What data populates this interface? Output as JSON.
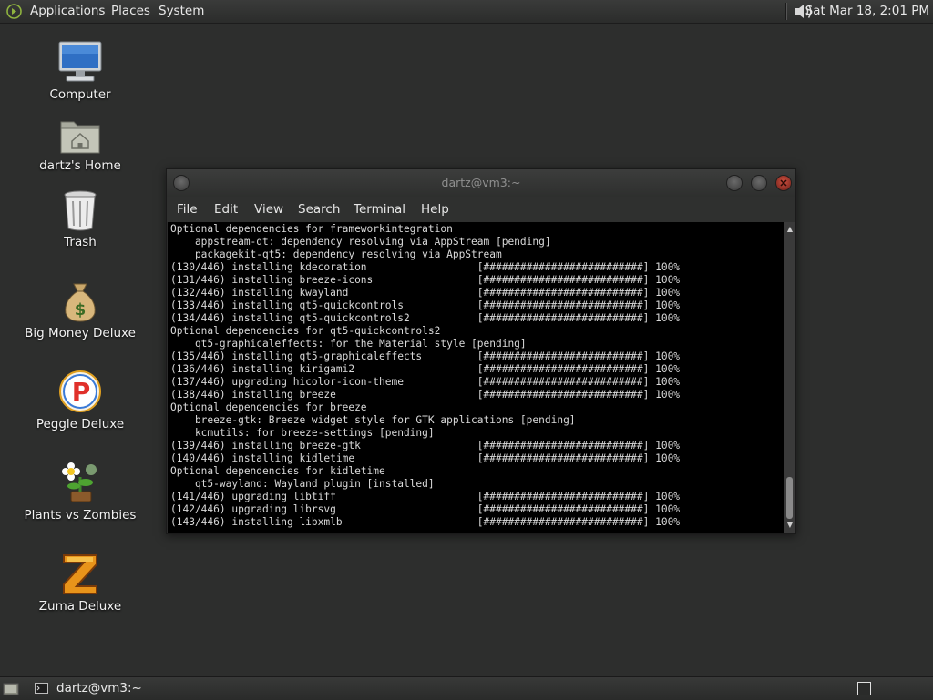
{
  "top_panel": {
    "menus": [
      "Applications",
      "Places",
      "System"
    ],
    "clock": "Sat Mar 18,  2:01 PM",
    "icons": [
      "applications-icon",
      "volume-icon"
    ]
  },
  "desktop": {
    "icons": [
      {
        "label": "Computer",
        "icon": "computer-icon"
      },
      {
        "label": "dartz's Home",
        "icon": "home-folder-icon"
      },
      {
        "label": "Trash",
        "icon": "trash-icon"
      },
      {
        "label": "Big Money Deluxe",
        "icon": "money-bag-icon"
      },
      {
        "label": "Peggle Deluxe",
        "icon": "peggle-icon"
      },
      {
        "label": "Plants vs Zombies",
        "icon": "plants-vs-zombies-icon"
      },
      {
        "label": "Zuma Deluxe",
        "icon": "zuma-icon"
      }
    ]
  },
  "terminal": {
    "title": "dartz@vm3:~",
    "menu": [
      "File",
      "Edit",
      "View",
      "Search",
      "Terminal",
      "Help"
    ],
    "lines": [
      "Optional dependencies for frameworkintegration",
      "    appstream-qt: dependency resolving via AppStream [pending]",
      "    packagekit-qt5: dependency resolving via AppStream",
      "(130/446) installing kdecoration                  [##########################] 100%",
      "(131/446) installing breeze-icons                 [##########################] 100%",
      "(132/446) installing kwayland                     [##########################] 100%",
      "(133/446) installing qt5-quickcontrols            [##########################] 100%",
      "(134/446) installing qt5-quickcontrols2           [##########################] 100%",
      "Optional dependencies for qt5-quickcontrols2",
      "    qt5-graphicaleffects: for the Material style [pending]",
      "(135/446) installing qt5-graphicaleffects         [##########################] 100%",
      "(136/446) installing kirigami2                    [##########################] 100%",
      "(137/446) upgrading hicolor-icon-theme            [##########################] 100%",
      "(138/446) installing breeze                       [##########################] 100%",
      "Optional dependencies for breeze",
      "    breeze-gtk: Breeze widget style for GTK applications [pending]",
      "    kcmutils: for breeze-settings [pending]",
      "(139/446) installing breeze-gtk                   [##########################] 100%",
      "(140/446) installing kidletime                    [##########################] 100%",
      "Optional dependencies for kidletime",
      "    qt5-wayland: Wayland plugin [installed]",
      "(141/446) upgrading libtiff                       [##########################] 100%",
      "(142/446) upgrading librsvg                       [##########################] 100%",
      "(143/446) installing libxmlb                      [##########################] 100%"
    ]
  },
  "bottom_panel": {
    "tasks": [
      {
        "label": "dartz@vm3:~",
        "icon": "terminal-icon"
      }
    ]
  }
}
